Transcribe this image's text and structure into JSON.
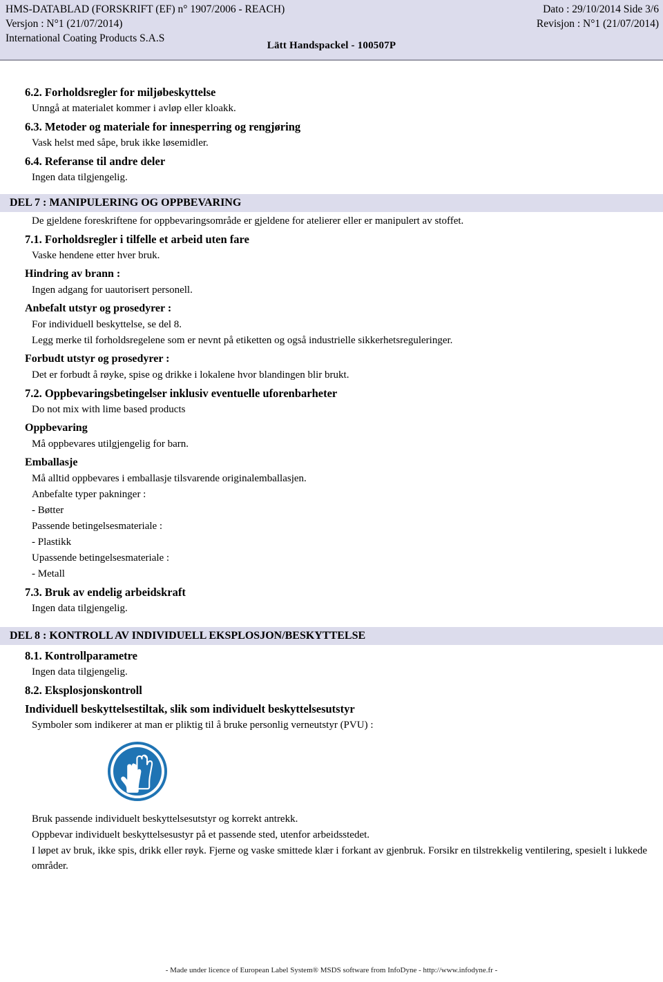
{
  "header": {
    "left_lines": [
      "HMS-DATABLAD (FORSKRIFT (EF) n° 1907/2006 - REACH)",
      "Versjon : N°1 (21/07/2014)",
      "International Coating Products S.A.S"
    ],
    "right_lines": [
      "Dato : 29/10/2014    Side 3/6",
      "Revisjon : N°1 (21/07/2014)"
    ],
    "product_title": "Lätt Handspackel  - 100507P",
    "band_color": "#dcdcec"
  },
  "body": {
    "s62_heading": "6.2. Forholdsregler for miljøbeskyttelse",
    "s62_text": "Unngå at materialet kommer i avløp eller kloakk.",
    "s63_heading": "6.3. Metoder og materiale for innesperring og rengjøring",
    "s63_text": "Vask helst med såpe, bruk ikke løsemidler.",
    "s64_heading": "6.4. Referanse til andre deler",
    "s64_text": "Ingen data tilgjengelig.",
    "del7_banner": "DEL 7 : MANIPULERING OG OPPBEVARING",
    "del7_intro": "De gjeldene foreskriftene for oppbevaringsområde er gjeldene for atelierer eller er manipulert av stoffet.",
    "s71_heading": "7.1. Forholdsregler i tilfelle et arbeid uten fare",
    "s71_text": "Vaske hendene etter hver bruk.",
    "fire_heading": "Hindring av brann :",
    "fire_text": "Ingen adgang for uautorisert personell.",
    "rec_heading": "Anbefalt utstyr og prosedyrer :",
    "rec_text1": "For individuell beskyttelse, se del 8.",
    "rec_text2": "Legg merke til forholdsregelene som er nevnt på etiketten og også industrielle sikkerhetsreguleringer.",
    "forb_heading": "Forbudt utstyr og prosedyrer :",
    "forb_text": "Det er forbudt å røyke, spise og drikke i lokalene hvor blandingen blir brukt.",
    "s72_heading": "7.2. Oppbevaringsbetingelser inklusiv eventuelle uforenbarheter",
    "s72_text": "Do not mix with lime based products",
    "storage_heading": "Oppbevaring",
    "storage_text": "Må oppbevares utilgjengelig for barn.",
    "pack_heading": "Emballasje",
    "pack_text1": "Må alltid oppbevares i emballasje tilsvarende originalemballasjen.",
    "pack_text2": "Anbefalte typer pakninger :",
    "pack_text3": "- Bøtter",
    "pack_text4": "Passende betingelsesmateriale :",
    "pack_text5": "- Plastikk",
    "pack_text6": "Upassende betingelsesmateriale :",
    "pack_text7": "- Metall",
    "s73_heading": "7.3. Bruk av endelig arbeidskraft",
    "s73_text": "Ingen data tilgjengelig.",
    "del8_banner": "DEL 8 : KONTROLL AV INDIVIDUELL EKSPLOSJON/BESKYTTELSE",
    "s81_heading": "8.1. Kontrollparametre",
    "s81_text": "Ingen data tilgjengelig.",
    "s82_heading": "8.2. Eksplosjonskontroll",
    "ppe_heading": "Individuell beskyttelsestiltak, slik som individuelt beskyttelsesutstyr",
    "ppe_text": "Symboler som indikerer at man er pliktig til å bruke personlig verneutstyr (PVU) :",
    "pictogram_name": "protective-gloves-mandatory",
    "pictogram_color": "#1f74b4",
    "after1": "Bruk passende individuelt beskyttelsesutstyr og korrekt antrekk.",
    "after2": "Oppbevar individuelt beskyttelsesustyr på et passende sted, utenfor arbeidsstedet.",
    "after3": "I løpet av bruk, ikke spis, drikk eller røyk. Fjerne og vaske smittede klær i forkant av gjenbruk. Forsikr en tilstrekkelig ventilering, spesielt i lukkede områder."
  },
  "footer": {
    "text": "- Made under licence of European Label System® MSDS software from InfoDyne  - http://www.infodyne.fr -"
  }
}
